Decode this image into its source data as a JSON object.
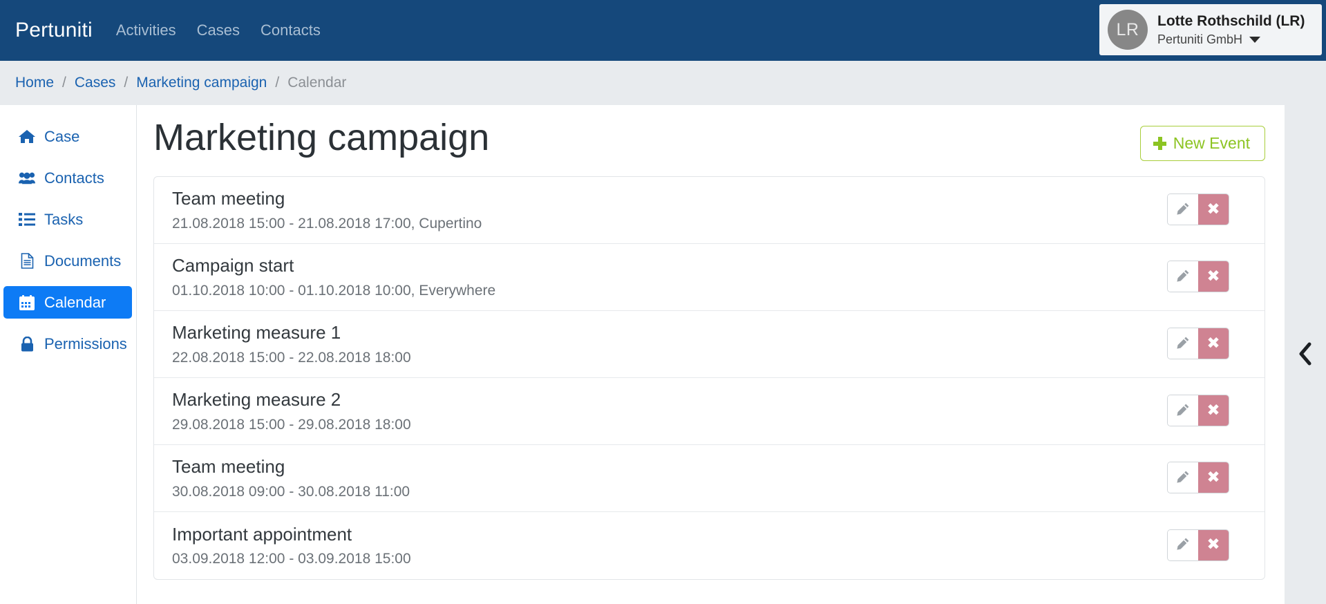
{
  "navbar": {
    "brand": "Pertuniti",
    "links": [
      {
        "label": "Activities"
      },
      {
        "label": "Cases"
      },
      {
        "label": "Contacts"
      }
    ],
    "user": {
      "initials": "LR",
      "name": "Lotte Rothschild (LR)",
      "organization": "Pertuniti GmbH"
    },
    "background_color": "#15487b",
    "link_color": "#a9bed3"
  },
  "breadcrumb": {
    "separator": "/",
    "items": [
      {
        "label": "Home",
        "current": false
      },
      {
        "label": "Cases",
        "current": false
      },
      {
        "label": "Marketing campaign",
        "current": false
      },
      {
        "label": "Calendar",
        "current": true
      }
    ],
    "link_color": "#1a62b0",
    "current_color": "#8b8f94"
  },
  "sidebar": {
    "items": [
      {
        "label": "Case",
        "icon": "home-icon",
        "active": false
      },
      {
        "label": "Contacts",
        "icon": "users-icon",
        "active": false
      },
      {
        "label": "Tasks",
        "icon": "list-icon",
        "active": false
      },
      {
        "label": "Documents",
        "icon": "file-icon",
        "active": false
      },
      {
        "label": "Calendar",
        "icon": "calendar-icon",
        "active": true
      },
      {
        "label": "Permissions",
        "icon": "lock-icon",
        "active": false
      }
    ],
    "active_color": "#0d7bf5",
    "link_color": "#1a62b0"
  },
  "main": {
    "title": "Marketing campaign",
    "new_event_label": "New Event",
    "new_event_icon": "plus-icon",
    "new_event_color": "#8cc422",
    "edit_icon": "pencil-icon",
    "delete_icon": "close-icon",
    "delete_glyph": "✖",
    "delete_color": "#cf8392",
    "events": [
      {
        "title": "Team meeting",
        "meta": "21.08.2018 15:00 - 21.08.2018 17:00, Cupertino"
      },
      {
        "title": "Campaign start",
        "meta": "01.10.2018 10:00 - 01.10.2018 10:00, Everywhere"
      },
      {
        "title": "Marketing measure 1",
        "meta": "22.08.2018 15:00 - 22.08.2018 18:00"
      },
      {
        "title": "Marketing measure 2",
        "meta": "29.08.2018 15:00 - 29.08.2018 18:00"
      },
      {
        "title": "Team meeting",
        "meta": "30.08.2018 09:00 - 30.08.2018 11:00"
      },
      {
        "title": "Important appointment",
        "meta": "03.09.2018 12:00 - 03.09.2018 15:00"
      }
    ]
  },
  "right_gutter": {
    "collapse_icon": "chevron-left-icon"
  }
}
